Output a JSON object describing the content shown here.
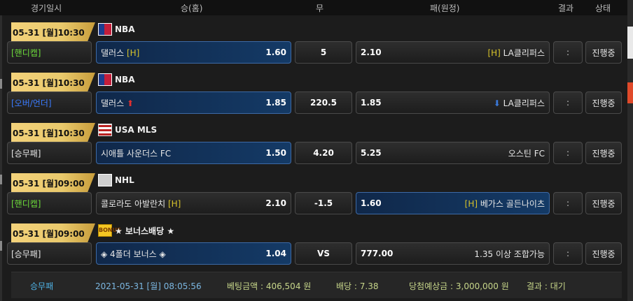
{
  "header": {
    "col_datetime": "경기일시",
    "col_home": "승(홈)",
    "col_draw": "무",
    "col_away": "패(원정)",
    "col_result": "결과",
    "col_status": "상태"
  },
  "matches": [
    {
      "date": "05-31 [월]10:30",
      "league": "NBA",
      "league_icon": "nba-logo-icon",
      "bet_type": "[핸디캡]",
      "bet_type_color": "#6ddc3a",
      "home": "댈러스",
      "home_tag": "[H]",
      "home_odds": "1.60",
      "draw": "5",
      "away": "LA클리퍼스",
      "away_tag": "[H]",
      "away_odds": "2.10",
      "result": ":",
      "status": "진행중",
      "selected": "home"
    },
    {
      "date": "05-31 [월]10:30",
      "league": "NBA",
      "league_icon": "nba-logo-icon",
      "bet_type": "[오버/언더]",
      "bet_type_color": "#3a7bff",
      "home": "댈러스",
      "home_arrow": "⬆",
      "home_odds": "1.85",
      "draw": "220.5",
      "away": "LA클리퍼스",
      "away_arrow": "⬇",
      "away_odds": "1.85",
      "result": ":",
      "status": "진행중",
      "selected": "home"
    },
    {
      "date": "05-31 [월]10:30",
      "league": "USA MLS",
      "league_icon": "usa-flag-icon",
      "bet_type": "[승무패]",
      "bet_type_color": "#e6e6e6",
      "home": "시애틀 사운더스 FC",
      "home_odds": "1.50",
      "draw": "4.20",
      "away": "오스틴 FC",
      "away_odds": "5.25",
      "result": ":",
      "status": "진행중",
      "selected": "home"
    },
    {
      "date": "05-31 [월]09:00",
      "league": "NHL",
      "league_icon": "nhl-logo-icon",
      "bet_type": "[핸디캡]",
      "bet_type_color": "#6ddc3a",
      "home": "콜로라도 아발란치",
      "home_tag": "[H]",
      "home_odds": "2.10",
      "draw": "-1.5",
      "away": "베가스 골든나이츠",
      "away_tag": "[H]",
      "away_odds": "1.60",
      "result": ":",
      "status": "진행중",
      "selected": "away"
    },
    {
      "date": "05-31 [월]09:00",
      "league": "★ 보너스배당 ★",
      "league_icon": "bonus-badge-icon",
      "league_icon_text": "BONUS",
      "bet_type": "[승무패]",
      "bet_type_color": "#e6e6e6",
      "home": "◈ 4폴더 보너스 ◈",
      "home_odds": "1.04",
      "draw": "VS",
      "away": "1.35 이상 조합가능",
      "away_odds": "777.00",
      "result": ":",
      "status": "진행중",
      "selected": "home"
    }
  ],
  "summary": {
    "type": "승무패",
    "datetime": "2021-05-31 [월] 08:05:56",
    "bet_amount": "베팅금액 : 406,504 원",
    "odds": "배당 : 7.38",
    "expected_win": "당첨예상금 : 3,000,000 원",
    "result": "결과 : 대기"
  }
}
